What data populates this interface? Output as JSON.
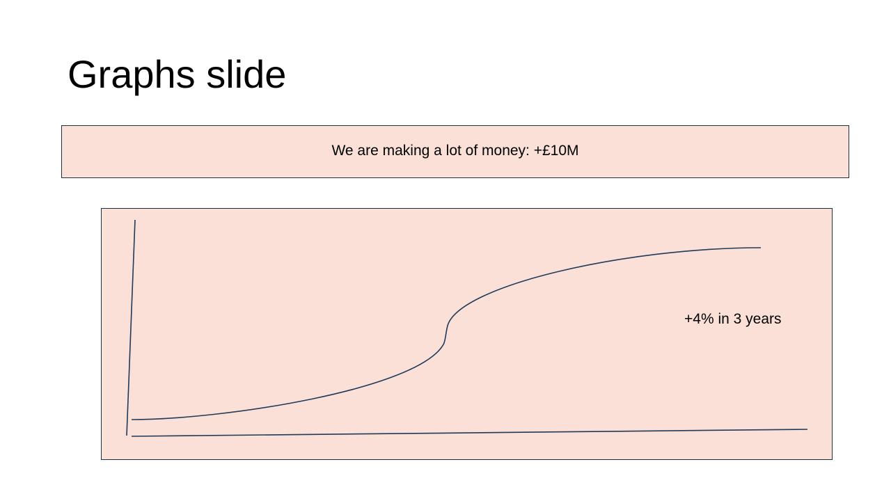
{
  "slide": {
    "title": "Graphs slide"
  },
  "callout": {
    "text": "We are making a lot of money: +£10M"
  },
  "graph": {
    "annotation": "+4% in 3 years",
    "colors": {
      "fill": "#fae0d6",
      "stroke": "#1f3a5a"
    }
  }
}
